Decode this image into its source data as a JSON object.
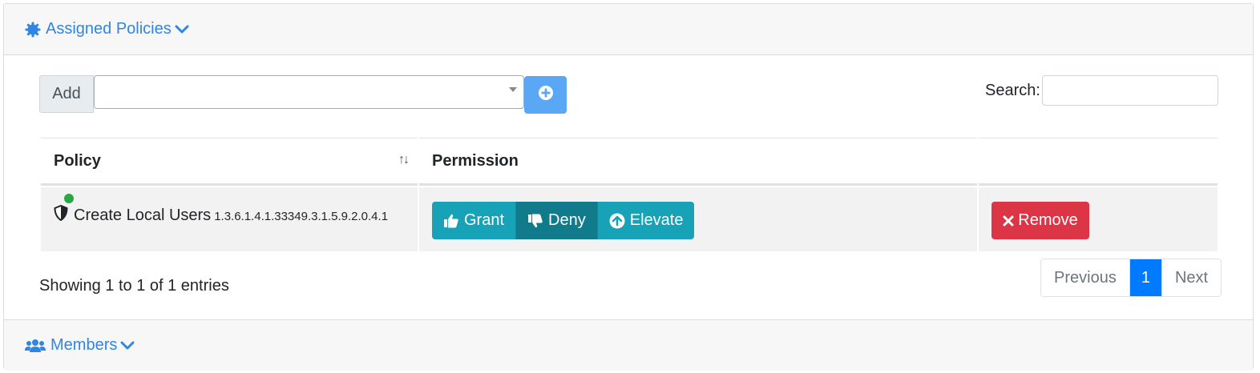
{
  "policies_section": {
    "title": "Assigned Policies",
    "icon": "gear-badge-icon",
    "accent_color": "#2f86e3"
  },
  "add": {
    "label": "Add",
    "select_value": "",
    "add_button_icon": "plus-circle-icon"
  },
  "search": {
    "label": "Search:",
    "value": ""
  },
  "table": {
    "columns": [
      "Policy",
      "Permission",
      ""
    ],
    "rows": [
      {
        "status": "active",
        "status_color": "#28a745",
        "icon": "shield-icon",
        "name": "Create Local Users",
        "oid": "1.3.6.1.4.1.33349.3.1.5.9.2.0.4.1",
        "permissions": {
          "grant": "Grant",
          "deny": "Deny",
          "elevate": "Elevate",
          "selected": "Deny"
        },
        "remove_label": "Remove"
      }
    ]
  },
  "info": "Showing 1 to 1 of 1 entries",
  "pagination": {
    "previous": "Previous",
    "current": "1",
    "next": "Next"
  },
  "members_section": {
    "title": "Members",
    "icon": "users-icon"
  }
}
